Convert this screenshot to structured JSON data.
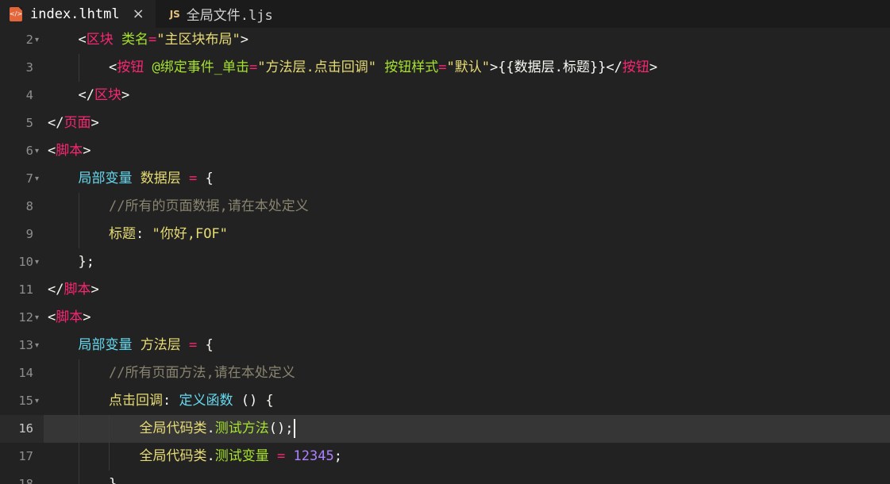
{
  "tabs": [
    {
      "label": "index.lhtml",
      "icon": "html-file-icon",
      "active": true,
      "close": "×"
    },
    {
      "label": "全局文件.ljs",
      "badge": "JS",
      "icon": "js-file-icon",
      "active": false
    }
  ],
  "editor": {
    "current_line": "16",
    "lines": [
      {
        "num": "2",
        "fold": true,
        "indent": 1,
        "tokens": [
          [
            "punc",
            "<"
          ],
          [
            "tag",
            "区块"
          ],
          [
            "plain",
            " "
          ],
          [
            "attr",
            "类名"
          ],
          [
            "op",
            "="
          ],
          [
            "str",
            "\"主区块布局\""
          ],
          [
            "punc",
            ">"
          ]
        ]
      },
      {
        "num": "3",
        "fold": false,
        "indent": 2,
        "tokens": [
          [
            "punc",
            "<"
          ],
          [
            "tag",
            "按钮"
          ],
          [
            "plain",
            " "
          ],
          [
            "attr",
            "@绑定事件_单击"
          ],
          [
            "op",
            "="
          ],
          [
            "str",
            "\"方法层.点击回调\""
          ],
          [
            "plain",
            " "
          ],
          [
            "attr",
            "按钮样式"
          ],
          [
            "op",
            "="
          ],
          [
            "str",
            "\"默认\""
          ],
          [
            "punc",
            ">{{数据层.标题}}</"
          ],
          [
            "tag",
            "按钮"
          ],
          [
            "punc",
            ">"
          ]
        ]
      },
      {
        "num": "4",
        "fold": false,
        "indent": 1,
        "tokens": [
          [
            "punc",
            "</"
          ],
          [
            "tag",
            "区块"
          ],
          [
            "punc",
            ">"
          ]
        ]
      },
      {
        "num": "5",
        "fold": false,
        "indent": 0,
        "tokens": [
          [
            "punc",
            "</"
          ],
          [
            "tag",
            "页面"
          ],
          [
            "punc",
            ">"
          ]
        ]
      },
      {
        "num": "6",
        "fold": true,
        "indent": 0,
        "tokens": [
          [
            "punc",
            "<"
          ],
          [
            "tag",
            "脚本"
          ],
          [
            "punc",
            ">"
          ]
        ]
      },
      {
        "num": "7",
        "fold": true,
        "indent": 1,
        "tokens": [
          [
            "kw",
            "局部变量"
          ],
          [
            "plain",
            " "
          ],
          [
            "var",
            "数据层"
          ],
          [
            "plain",
            " "
          ],
          [
            "op",
            "="
          ],
          [
            "plain",
            " {"
          ]
        ]
      },
      {
        "num": "8",
        "fold": false,
        "indent": 2,
        "tokens": [
          [
            "cmt",
            "//所有的页面数据,请在本处定义"
          ]
        ]
      },
      {
        "num": "9",
        "fold": false,
        "indent": 2,
        "tokens": [
          [
            "var",
            "标题"
          ],
          [
            "plain",
            ": "
          ],
          [
            "str",
            "\"你好,FOF\""
          ]
        ]
      },
      {
        "num": "10",
        "fold": true,
        "indent": 1,
        "tokens": [
          [
            "plain",
            "};"
          ]
        ]
      },
      {
        "num": "11",
        "fold": false,
        "indent": 0,
        "tokens": [
          [
            "punc",
            "</"
          ],
          [
            "tag",
            "脚本"
          ],
          [
            "punc",
            ">"
          ]
        ]
      },
      {
        "num": "12",
        "fold": true,
        "indent": 0,
        "tokens": [
          [
            "punc",
            "<"
          ],
          [
            "tag",
            "脚本"
          ],
          [
            "punc",
            ">"
          ]
        ]
      },
      {
        "num": "13",
        "fold": true,
        "indent": 1,
        "tokens": [
          [
            "kw",
            "局部变量"
          ],
          [
            "plain",
            " "
          ],
          [
            "var",
            "方法层"
          ],
          [
            "plain",
            " "
          ],
          [
            "op",
            "="
          ],
          [
            "plain",
            " {"
          ]
        ]
      },
      {
        "num": "14",
        "fold": false,
        "indent": 2,
        "tokens": [
          [
            "cmt",
            "//所有页面方法,请在本处定义"
          ]
        ]
      },
      {
        "num": "15",
        "fold": true,
        "indent": 2,
        "tokens": [
          [
            "var",
            "点击回调"
          ],
          [
            "plain",
            ": "
          ],
          [
            "kw",
            "定义函数"
          ],
          [
            "plain",
            " () {"
          ]
        ]
      },
      {
        "num": "16",
        "fold": false,
        "indent": 3,
        "cursor": true,
        "tokens": [
          [
            "var",
            "全局代码类"
          ],
          [
            "plain",
            "."
          ],
          [
            "fn",
            "测试方法"
          ],
          [
            "plain",
            "();"
          ]
        ]
      },
      {
        "num": "17",
        "fold": false,
        "indent": 3,
        "tokens": [
          [
            "var",
            "全局代码类"
          ],
          [
            "plain",
            "."
          ],
          [
            "fn",
            "测试变量"
          ],
          [
            "plain",
            " "
          ],
          [
            "op",
            "="
          ],
          [
            "plain",
            " "
          ],
          [
            "num",
            "12345"
          ],
          [
            "plain",
            ";"
          ]
        ]
      },
      {
        "num": "18",
        "fold": false,
        "indent": 2,
        "tokens": [
          [
            "plain",
            "},"
          ]
        ]
      }
    ]
  },
  "colors": {
    "background": "#222222",
    "tag": "#f92672",
    "attribute": "#a6e22e",
    "string": "#e6db74",
    "keyword": "#66d9ef",
    "number": "#ae81ff",
    "comment": "#88846f"
  }
}
